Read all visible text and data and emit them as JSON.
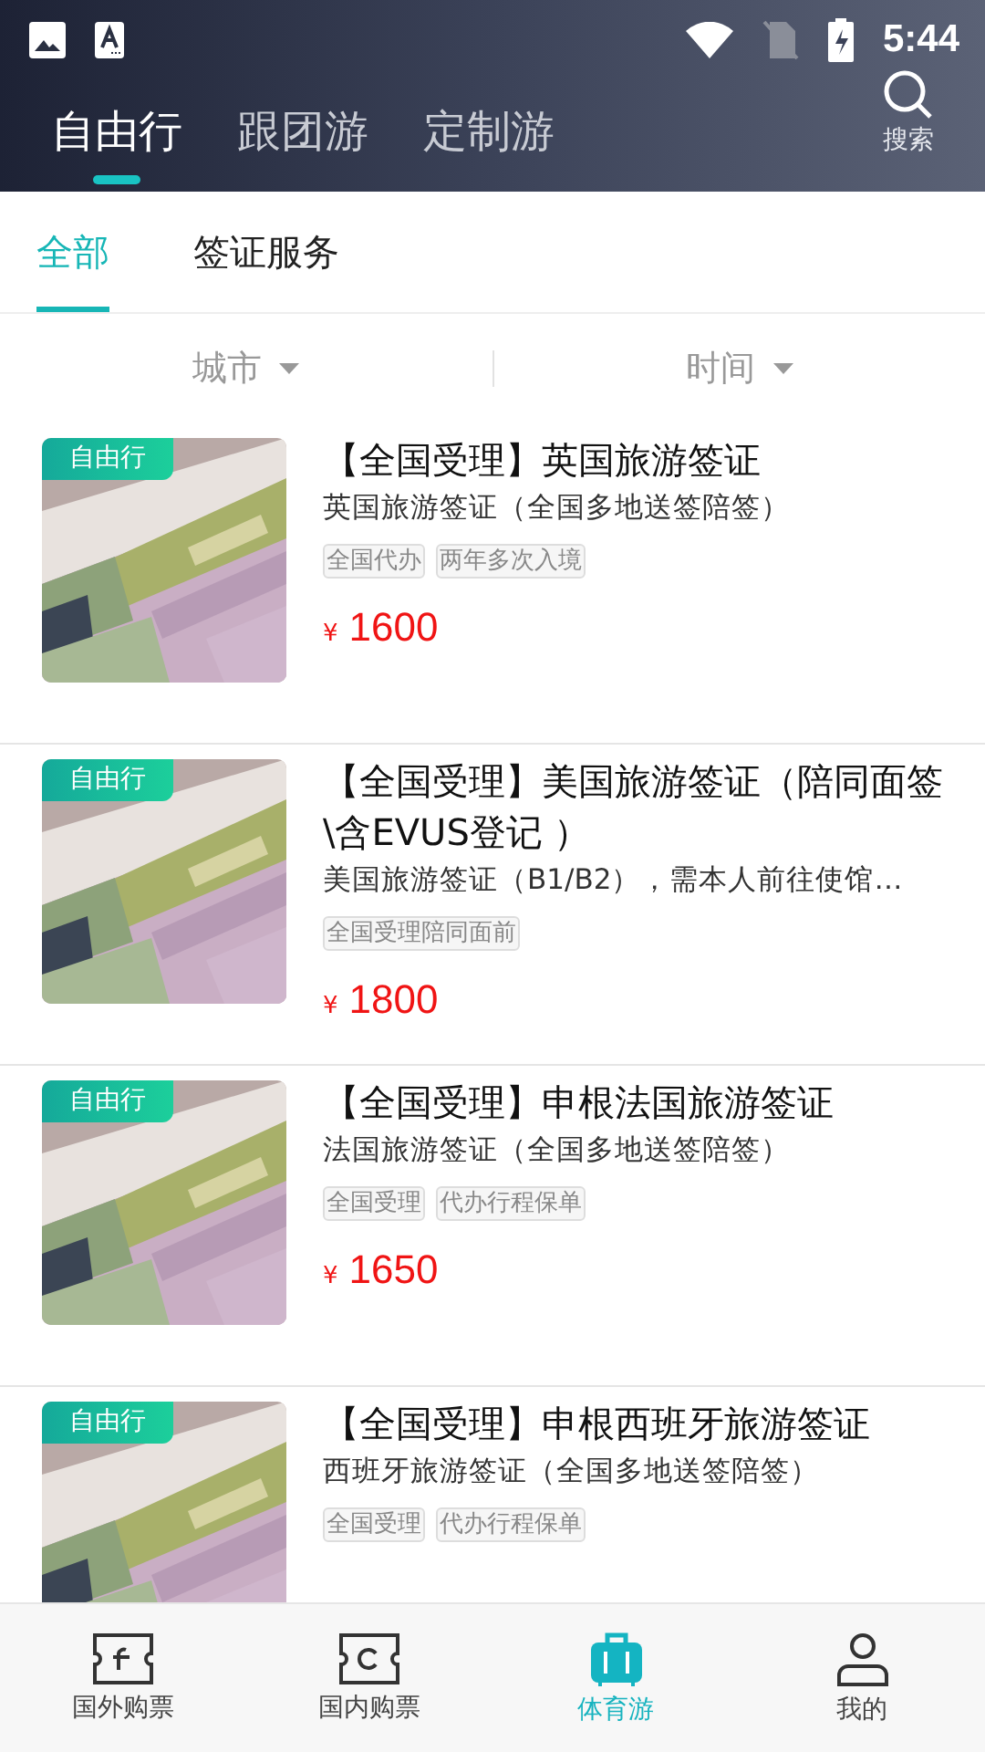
{
  "status_bar": {
    "time": "5:44"
  },
  "top_tabs": [
    {
      "label": "自由行",
      "selected": true
    },
    {
      "label": "跟团游",
      "selected": false
    },
    {
      "label": "定制游",
      "selected": false
    }
  ],
  "search": {
    "label": "搜索"
  },
  "sub_tabs": [
    {
      "label": "全部",
      "selected": true
    },
    {
      "label": "签证服务",
      "selected": false
    }
  ],
  "filters": [
    {
      "label": "城市"
    },
    {
      "label": "时间"
    }
  ],
  "products": [
    {
      "badge": "自由行",
      "title": "【全国受理】英国旅游签证",
      "subtitle": "英国旅游签证（全国多地送签陪签）",
      "tags": [
        "全国代办",
        "两年多次入境"
      ],
      "currency": "¥",
      "price": "1600"
    },
    {
      "badge": "自由行",
      "title": "【全国受理】美国旅游签证（陪同面签\\含EVUS登记 ）",
      "subtitle": "美国旅游签证（B1/B2），需本人前往使馆…",
      "tags": [
        "全国受理陪同面前"
      ],
      "currency": "¥",
      "price": "1800"
    },
    {
      "badge": "自由行",
      "title": "【全国受理】申根法国旅游签证",
      "subtitle": "法国旅游签证（全国多地送签陪签）",
      "tags": [
        "全国受理",
        "代办行程保单"
      ],
      "currency": "¥",
      "price": "1650"
    },
    {
      "badge": "自由行",
      "title": "【全国受理】申根西班牙旅游签证",
      "subtitle": "西班牙旅游签证（全国多地送签陪签）",
      "tags": [
        "全国受理",
        "代办行程保单"
      ]
    }
  ],
  "bottom_nav": [
    {
      "label": "国外购票",
      "kind": "ticket",
      "selected": false
    },
    {
      "label": "国内购票",
      "kind": "ticket2",
      "selected": false
    },
    {
      "label": "体育游",
      "kind": "bag",
      "selected": true
    },
    {
      "label": "我的",
      "kind": "person",
      "selected": false
    }
  ]
}
